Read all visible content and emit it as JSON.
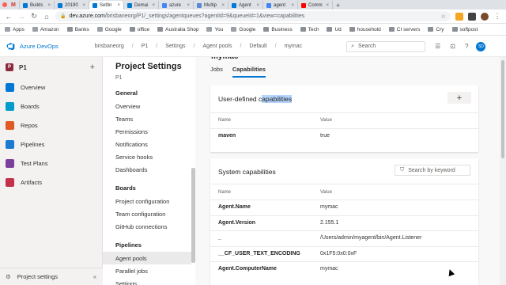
{
  "browser": {
    "tabs": [
      {
        "label": "Builds",
        "color": "#0078d4",
        "active": false
      },
      {
        "label": "20190",
        "color": "#0078d4",
        "active": false
      },
      {
        "label": "Settin",
        "color": "#0078d4",
        "active": true
      },
      {
        "label": "Demai",
        "color": "#0078d4",
        "active": false
      },
      {
        "label": "azure",
        "color": "#4285f4",
        "active": false
      },
      {
        "label": "Multip",
        "color": "#5b8bd6",
        "active": false
      },
      {
        "label": "Agent",
        "color": "#0078d4",
        "active": false
      },
      {
        "label": "agent",
        "color": "#4285f4",
        "active": false
      },
      {
        "label": "Comm",
        "color": "#ff0000",
        "active": false
      }
    ],
    "gmail_letter": "M",
    "newtab": "+",
    "url_host": "dev.azure.com",
    "url_path": "/brisbaneorg/P1/_settings/agentqueues?agentId=9&queueId=1&view=capabilities",
    "bookmarks": [
      {
        "label": "Apps",
        "folder": false
      },
      {
        "label": "Amazon",
        "folder": false
      },
      {
        "label": "Banks",
        "folder": true
      },
      {
        "label": "Google",
        "folder": false
      },
      {
        "label": "office",
        "folder": true
      },
      {
        "label": "Australia Shop",
        "folder": true
      },
      {
        "label": "You",
        "folder": false
      },
      {
        "label": "Google",
        "folder": false
      },
      {
        "label": "Business",
        "folder": true
      },
      {
        "label": "Tech",
        "folder": true
      },
      {
        "label": "Ud",
        "folder": true
      },
      {
        "label": "household",
        "folder": true
      },
      {
        "label": "CI servers",
        "folder": true
      },
      {
        "label": "Cry",
        "folder": true
      },
      {
        "label": "softpost",
        "folder": true
      }
    ]
  },
  "header": {
    "product": "Azure DevOps",
    "breadcrumbs": [
      "brisbaneorg",
      "P1",
      "Settings",
      "Agent pools",
      "Default",
      "mymac"
    ],
    "search_placeholder": "Search",
    "avatar_initials": "SD",
    "accent": "#0078d4"
  },
  "leftnav": {
    "project_initial": "P",
    "project_name": "P1",
    "add": "+",
    "items": [
      {
        "label": "Overview",
        "color": "#0078d4",
        "icon": "overview-icon"
      },
      {
        "label": "Boards",
        "color": "#009ccc",
        "icon": "boards-icon"
      },
      {
        "label": "Repos",
        "color": "#e05a22",
        "icon": "repos-icon"
      },
      {
        "label": "Pipelines",
        "color": "#1c7bd1",
        "icon": "pipelines-icon"
      },
      {
        "label": "Test Plans",
        "color": "#7c3f9b",
        "icon": "testplans-icon"
      },
      {
        "label": "Artifacts",
        "color": "#c4314b",
        "icon": "artifacts-icon"
      }
    ],
    "project_settings": "Project settings",
    "collapse": "«"
  },
  "settings": {
    "title": "Project Settings",
    "subtitle": "P1",
    "general_heading": "General",
    "general_items": [
      "Overview",
      "Teams",
      "Permissions",
      "Notifications",
      "Service hooks",
      "Dashboards"
    ],
    "boards_heading": "Boards",
    "boards_items": [
      "Project configuration",
      "Team configuration",
      "GitHub connections"
    ],
    "pipelines_heading": "Pipelines",
    "pipelines_items": [
      "Agent pools",
      "Parallel jobs",
      "Settings"
    ]
  },
  "main": {
    "pool_title": "mymac",
    "tabs": [
      "Jobs",
      "Capabilities"
    ],
    "user_defined": {
      "title_prefix": "User-defined c",
      "title_highlight": "apabilities",
      "add": "+",
      "col_name": "Name",
      "col_value": "Value",
      "rows": [
        {
          "name": "maven",
          "value": "true"
        }
      ]
    },
    "system": {
      "title": "System capabilities",
      "filter_placeholder": "Search by keyword",
      "col_name": "Name",
      "col_value": "Value",
      "rows": [
        {
          "name": "Agent.Name",
          "value": "mymac"
        },
        {
          "name": "Agent.Version",
          "value": "2.155.1"
        },
        {
          "name": "_",
          "value": "/Users/admin/myagent/bin/Agent.Listener"
        },
        {
          "name": "__CF_USER_TEXT_ENCODING",
          "value": "0x1F5:0x0:0xF"
        },
        {
          "name": "Agent.ComputerName",
          "value": "mymac"
        }
      ]
    }
  }
}
